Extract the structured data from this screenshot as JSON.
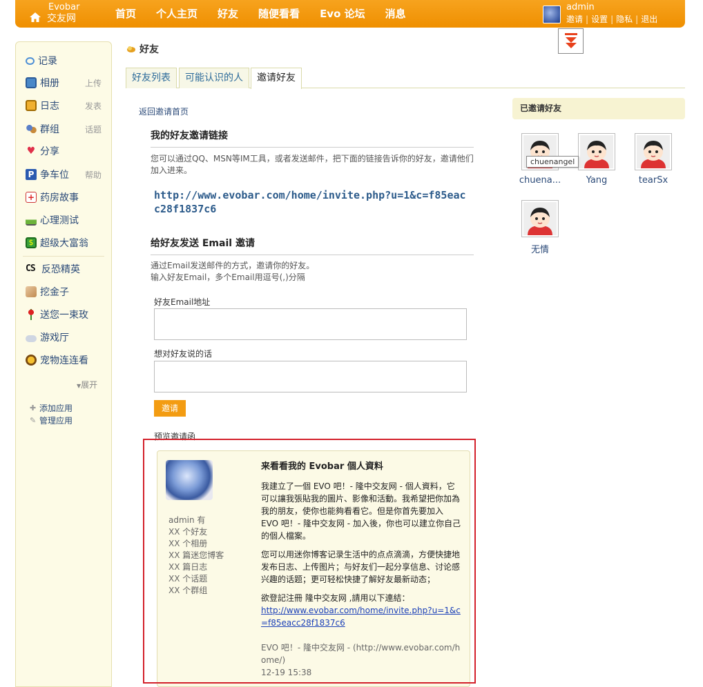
{
  "header": {
    "logo_line1": "Evobar",
    "logo_line2": "交友网",
    "nav": [
      "首页",
      "个人主页",
      "好友",
      "随便看看",
      "Evo 论坛",
      "消息"
    ],
    "user": {
      "name": "admin",
      "links": [
        "邀请",
        "设置",
        "隐私",
        "退出"
      ]
    },
    "brand_color": "#f39c12"
  },
  "sidebar": {
    "items": [
      {
        "label": "记录",
        "extra": "",
        "icon": "speech-bubble-icon"
      },
      {
        "label": "相册",
        "extra": "上传",
        "icon": "photo-icon"
      },
      {
        "label": "日志",
        "extra": "发表",
        "icon": "notebook-icon"
      },
      {
        "label": "群组",
        "extra": "话题",
        "icon": "group-icon"
      },
      {
        "label": "分享",
        "extra": "",
        "icon": "heart-icon"
      },
      {
        "label": "争车位",
        "extra": "帮助",
        "icon": "parking-icon"
      },
      {
        "label": "药房故事",
        "extra": "",
        "icon": "pharmacy-icon"
      },
      {
        "label": "心理测试",
        "extra": "",
        "icon": "flask-icon"
      },
      {
        "label": "超级大富翁",
        "extra": "",
        "icon": "money-icon"
      },
      {
        "label": "反恐精英",
        "extra": "",
        "icon": "cs-icon"
      },
      {
        "label": "挖金子",
        "extra": "",
        "icon": "gold-icon"
      },
      {
        "label": "送您一束玫",
        "extra": "",
        "icon": "rose-icon"
      },
      {
        "label": "游戏厅",
        "extra": "",
        "icon": "gamepad-icon"
      },
      {
        "label": "宠物连连看",
        "extra": "",
        "icon": "pet-icon"
      }
    ],
    "expand_label": "展开",
    "add_app": "添加应用",
    "manage_app": "管理应用"
  },
  "main": {
    "title": "好友",
    "tabs": [
      "好友列表",
      "可能认识的人",
      "邀请好友"
    ],
    "back_link": "返回邀请首页",
    "link_section": {
      "title": "我的好友邀请链接",
      "desc": "您可以通过QQ、MSN等IM工具，或者发送邮件，把下面的链接告诉你的好友，邀请他们加入进来。",
      "url": "http://www.evobar.com/home/invite.php?u=1&c=f85eacc28f1837c6"
    },
    "email_section": {
      "title": "给好友发送 Email 邀请",
      "desc1": "通过Email发送邮件的方式，邀请你的好友。",
      "desc2": "输入好友Email，多个Email用逗号(,)分隔",
      "email_label": "好友Email地址",
      "message_label": "想对好友说的话",
      "email_value": "",
      "message_value": "",
      "button": "邀请"
    },
    "preview": {
      "label": "预览邀请函",
      "stats": [
        "admin 有",
        "XX 个好友",
        "XX 个相册",
        "XX 篇迷您博客",
        "XX 篇日志",
        "XX 个话题",
        "XX 个群组"
      ],
      "title": "来看看我的 Evobar 個人資料",
      "p1": "我建立了一個 EVO 吧！- 隆中交友网 - 個人資料，它可以讓我張貼我的圖片、影像和活動。我希望把你加為我的朋友，使你也能夠看看它。但是你首先要加入 EVO 吧！- 隆中交友网 - 加入後，你也可以建立你自己的個人檔案。",
      "p2": "您可以用迷你博客记录生活中的点点滴滴，方便快捷地发布日志、上传图片；与好友们一起分享信息、讨论感兴趣的话题；更可轻松快捷了解好友最新动态；",
      "p3": "欲登記注冊 隆中交友网 ,請用以下連結：",
      "link": "http://www.evobar.com/home/invite.php?u=1&c=f85eacc28f1837c6",
      "footer": "EVO 吧！- 隆中交友网 - (http://www.evobar.com/home/)",
      "time": "12-19 15:38"
    }
  },
  "invited": {
    "title": "已邀请好友",
    "friends": [
      "chuena...",
      "Yang",
      "tearSx",
      "无情"
    ],
    "tooltip": "chuenangel"
  }
}
